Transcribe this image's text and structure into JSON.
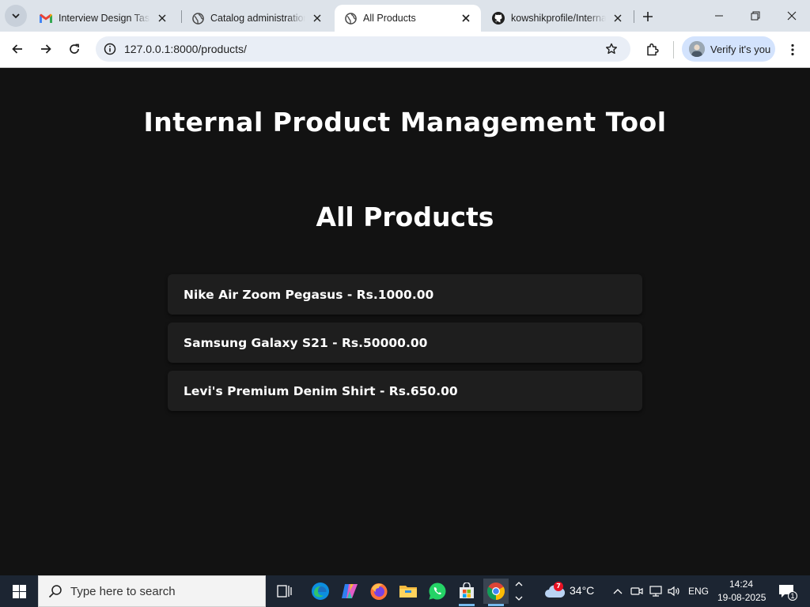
{
  "browser": {
    "tabs": [
      {
        "title": "Interview Design Task -",
        "favicon": "gmail-icon",
        "active": false
      },
      {
        "title": "Catalog administration",
        "favicon": "globe-icon",
        "active": false
      },
      {
        "title": "All Products",
        "favicon": "globe-icon",
        "active": true
      },
      {
        "title": "kowshikprofile/Interna",
        "favicon": "github-icon",
        "active": false
      }
    ],
    "url": "127.0.0.1:8000/products/",
    "profile_label": "Verify it's you"
  },
  "page": {
    "app_title": "Internal Product Management Tool",
    "section_title": "All Products",
    "products": [
      {
        "label": "Nike Air Zoom Pegasus - Rs.1000.00"
      },
      {
        "label": "Samsung Galaxy S21 - Rs.50000.00"
      },
      {
        "label": "Levi's Premium Denim Shirt - Rs.650.00"
      }
    ]
  },
  "taskbar": {
    "search_placeholder": "Type here to search",
    "weather_temp": "34°C",
    "weather_badge": "7",
    "language": "ENG",
    "time": "14:24",
    "date": "19-08-2025",
    "notification_count": "1"
  },
  "colors": {
    "page_bg": "#121212",
    "card_bg": "#1e1e1e",
    "tabstrip_bg": "#dde3ea",
    "omnibox_bg": "#e9eef6",
    "profile_bg": "#d3e3fd",
    "taskbar_bg": "#1c2532"
  }
}
